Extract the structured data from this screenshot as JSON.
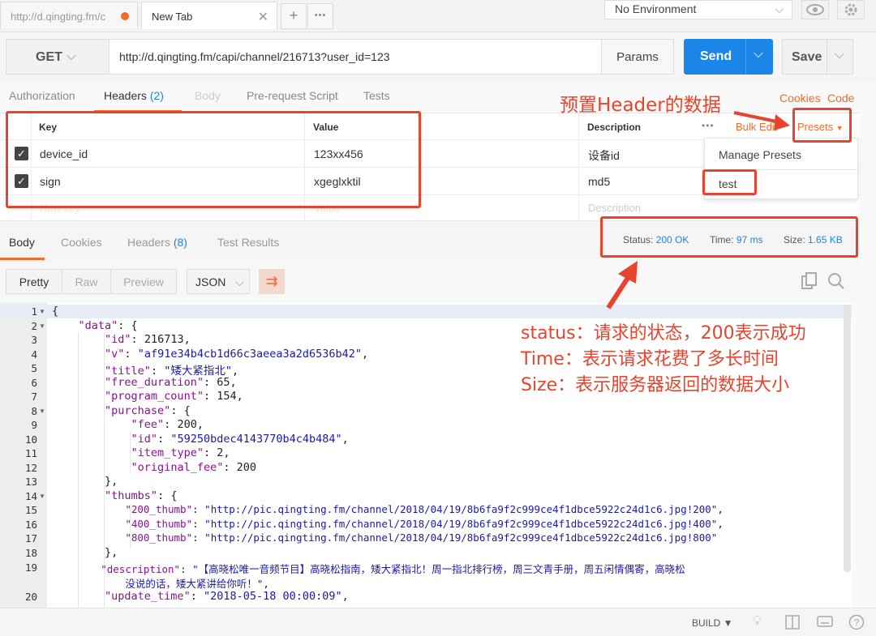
{
  "tabs": [
    {
      "label": "http://d.qingting.fm/c"
    },
    {
      "label": "New Tab"
    }
  ],
  "tab_add_label": "+",
  "tab_more_label": "•••",
  "environment": {
    "selected": "No Environment"
  },
  "request": {
    "method": "GET",
    "url": "http://d.qingting.fm/capi/channel/216713?user_id=123",
    "params_label": "Params",
    "send_label": "Send",
    "save_label": "Save"
  },
  "request_tabs": {
    "authorization": "Authorization",
    "headers": "Headers",
    "headers_count": "(2)",
    "body": "Body",
    "prerequest": "Pre-request Script",
    "tests": "Tests",
    "cookies": "Cookies",
    "code": "Code"
  },
  "headers_table": {
    "col_key": "Key",
    "col_value": "Value",
    "col_description": "Description",
    "more": "•••",
    "bulk_edit": "Bulk Edit",
    "presets": "Presets",
    "rows": [
      {
        "key": "device_id",
        "value": "123xx456",
        "description": "设备id"
      },
      {
        "key": "sign",
        "value": "xgeglxktil",
        "description": "md5"
      }
    ],
    "new_key_placeholder": "New key",
    "new_value_placeholder": "Value",
    "new_description_placeholder": "Description"
  },
  "presets_menu": {
    "manage": "Manage Presets",
    "item": "test"
  },
  "response_tabs": {
    "body": "Body",
    "cookies": "Cookies",
    "headers": "Headers",
    "headers_count": "(8)",
    "test_results": "Test Results"
  },
  "response_meta": {
    "status_label": "Status:",
    "status_value": "200 OK",
    "time_label": "Time:",
    "time_value": "97 ms",
    "size_label": "Size:",
    "size_value": "1.65 KB"
  },
  "view": {
    "pretty": "Pretty",
    "raw": "Raw",
    "preview": "Preview",
    "format": "JSON"
  },
  "code_lines": [
    {
      "n": "1",
      "fold": true
    },
    {
      "n": "2",
      "fold": true
    },
    {
      "n": "3"
    },
    {
      "n": "4"
    },
    {
      "n": "5"
    },
    {
      "n": "6"
    },
    {
      "n": "7"
    },
    {
      "n": "8",
      "fold": true
    },
    {
      "n": "9"
    },
    {
      "n": "10"
    },
    {
      "n": "11"
    },
    {
      "n": "12"
    },
    {
      "n": "13"
    },
    {
      "n": "14",
      "fold": true
    },
    {
      "n": "15"
    },
    {
      "n": "16"
    },
    {
      "n": "17"
    },
    {
      "n": "18"
    },
    {
      "n": "19"
    },
    {
      "n": "20"
    }
  ],
  "code": {
    "l1": "{",
    "l2_key": "\"data\"",
    "l2_rest": ": {",
    "l3_key": "\"id\"",
    "l3_val": "216713",
    "l4_key": "\"v\"",
    "l4_val": "\"af91e34b4cb1d66c3aeea3a2d6536b42\"",
    "l5_key": "\"title\"",
    "l5_val": "\"矮大紧指北\"",
    "l6_key": "\"free_duration\"",
    "l6_val": "65",
    "l7_key": "\"program_count\"",
    "l7_val": "154",
    "l8_key": "\"purchase\"",
    "l8_rest": ": {",
    "l9_key": "\"fee\"",
    "l9_val": "200",
    "l10_key": "\"id\"",
    "l10_val": "\"59250bdec4143770b4c4b484\"",
    "l11_key": "\"item_type\"",
    "l11_val": "2",
    "l12_key": "\"original_fee\"",
    "l12_val": "200",
    "l13": "},",
    "l14_key": "\"thumbs\"",
    "l14_rest": ": {",
    "l15_key": "\"200_thumb\"",
    "l15_val": "\"http://pic.qingting.fm/channel/2018/04/19/8b6fa9f2c999ce4f1dbce5922c24d1c6.jpg!200\"",
    "l16_key": "\"400_thumb\"",
    "l16_val": "\"http://pic.qingting.fm/channel/2018/04/19/8b6fa9f2c999ce4f1dbce5922c24d1c6.jpg!400\"",
    "l17_key": "\"800_thumb\"",
    "l17_val": "\"http://pic.qingting.fm/channel/2018/04/19/8b6fa9f2c999ce4f1dbce5922c24d1c6.jpg!800\"",
    "l18": "},",
    "l19_key": "\"description\"",
    "l19_val_a": "\"【高晓松唯一音频节目】高晓松指南，矮大紧指北！周一指北排行榜，周三文青手册，周五闲情偶寄，高晓松",
    "l19_val_b": "没说的话，矮大紧讲给你听！\"",
    "l20_key": "\"update_time\"",
    "l20_val": "\"2018-05-18 00:00:09\""
  },
  "footer": {
    "build": "BUILD"
  },
  "annotations": {
    "header_note": "预置Header的数据",
    "status_note": "status：请求的状态，200表示成功",
    "time_note": "Time：表示请求花费了多长时间",
    "size_note": "Size：表示服务器返回的数据大小"
  },
  "colors": {
    "accent": "#f26b2b",
    "send": "#1c85e8",
    "annotation": "#e8432d"
  }
}
